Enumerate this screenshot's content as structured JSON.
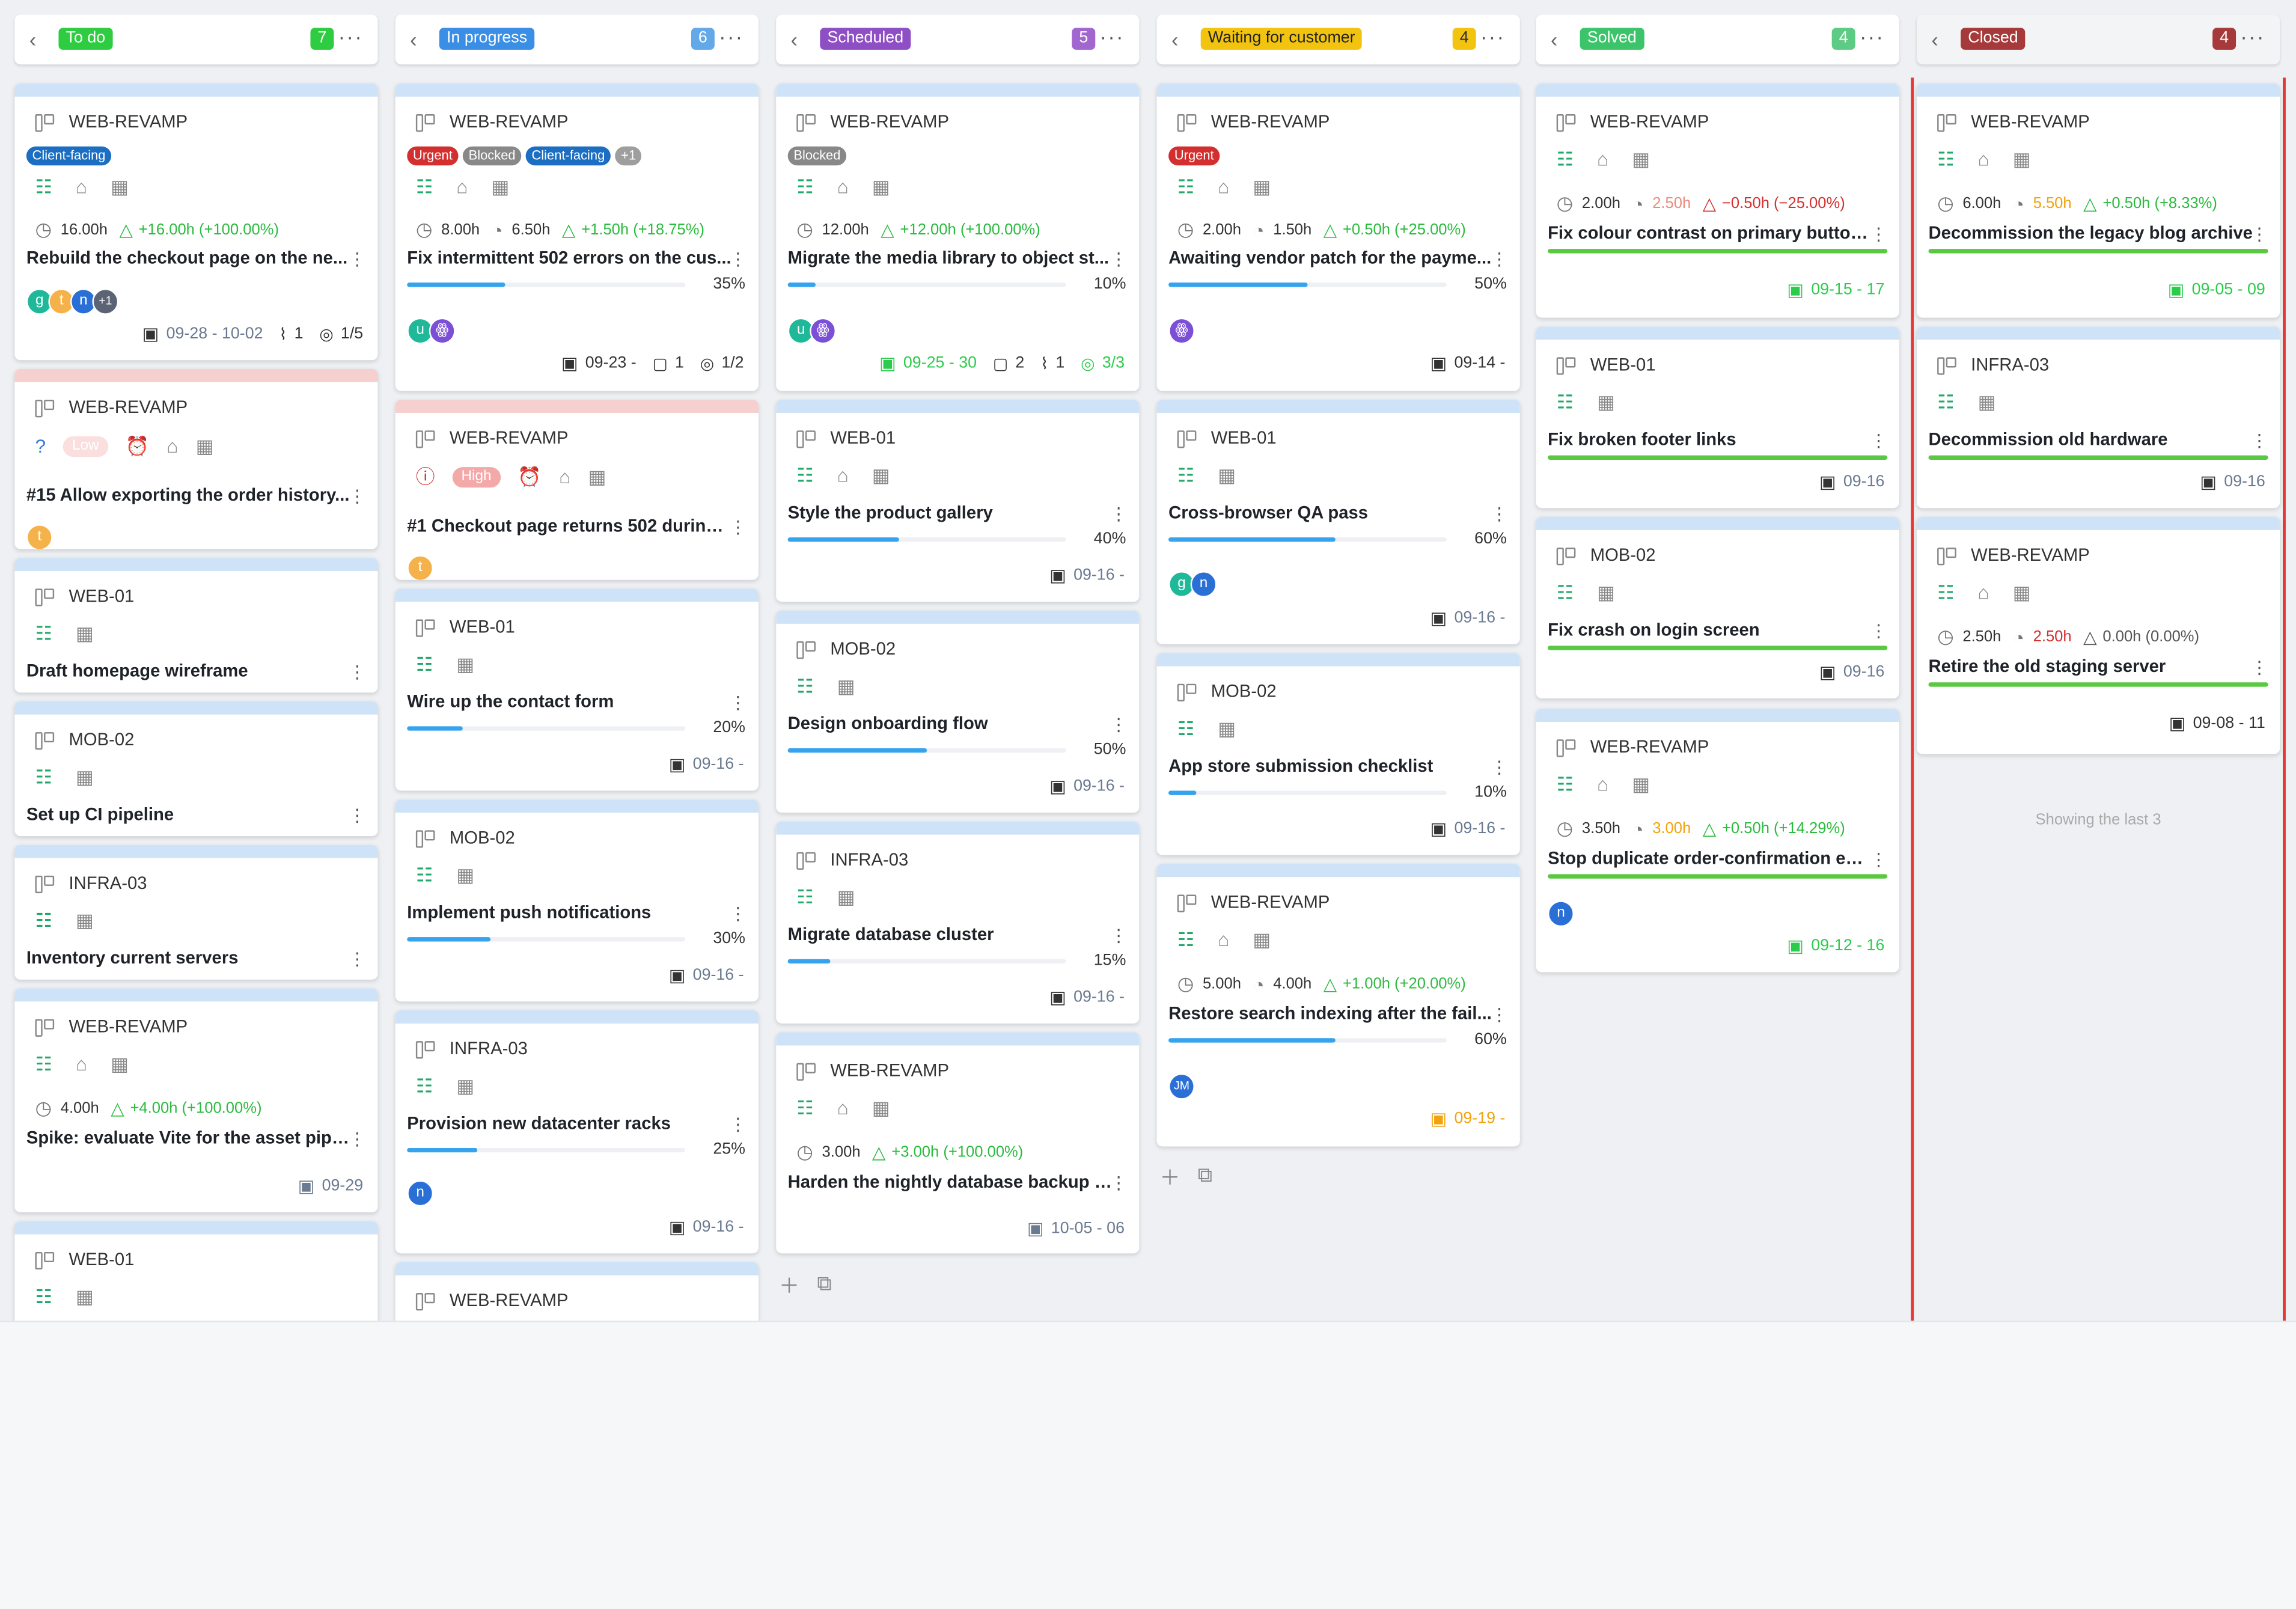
{
  "columns": [
    {
      "title": "To do",
      "count": "7",
      "tag_color": "#2ecc40",
      "count_color": "#2ecc40",
      "cards": [
        {
          "project": "WEB-REVAMP",
          "labels": [
            {
              "text": "Client-facing",
              "color": "#1b6ec2"
            }
          ],
          "estimate": "16.00h",
          "delta": "+16.00h (+100.00%)",
          "title": "Rebuild the checkout page on the ne...",
          "avatars": [
            {
              "text": "g",
              "color": "#1fb99a"
            },
            {
              "text": "t",
              "color": "#f6b24a"
            },
            {
              "text": "n",
              "color": "#2a6fd6"
            },
            {
              "text": "+1",
              "color": "#5b6475"
            }
          ],
          "date": "09-28 - 10-02",
          "attachments": "1",
          "checklist": "1/5"
        },
        {
          "project": "WEB-REVAMP",
          "priority": "Low",
          "title": "#15 Allow exporting the order history...",
          "avatars": [
            {
              "text": "t",
              "color": "#f6b24a"
            }
          ]
        },
        {
          "project": "WEB-01",
          "title": "Draft homepage wireframe"
        },
        {
          "project": "MOB-02",
          "title": "Set up CI pipeline"
        },
        {
          "project": "INFRA-03",
          "title": "Inventory current servers"
        },
        {
          "project": "WEB-REVAMP",
          "estimate": "4.00h",
          "delta": "+4.00h (+100.00%)",
          "title": "Spike: evaluate Vite for the asset pipe...",
          "date": "09-29"
        },
        {
          "project": "WEB-01"
        }
      ]
    },
    {
      "title": "In progress",
      "count": "6",
      "tag_color": "#3a8ee6",
      "count_color": "#63a8e8",
      "cards": [
        {
          "project": "WEB-REVAMP",
          "labels": [
            {
              "text": "Urgent",
              "color": "#d32f2f"
            },
            {
              "text": "Blocked",
              "color": "#888"
            },
            {
              "text": "Client-facing",
              "color": "#1b6ec2"
            },
            {
              "text": "+1",
              "color": "#9e9e9e"
            }
          ],
          "estimate": "8.00h",
          "spent": "6.50h",
          "delta": "+1.50h (+18.75%)",
          "title": "Fix intermittent 502 errors on the cus...",
          "progress": "35%",
          "avatars": [
            {
              "text": "u",
              "color": "#1fb99a"
            },
            {
              "text": "ꙮ",
              "color": "#7b4fd6"
            }
          ],
          "date": "09-23 -",
          "comments": "1",
          "checklist": "1/2"
        },
        {
          "project": "WEB-REVAMP",
          "priority": "High",
          "title": "#1 Checkout page returns 502 during ...",
          "avatars": [
            {
              "text": "t",
              "color": "#f6b24a"
            }
          ]
        },
        {
          "project": "WEB-01",
          "title": "Wire up the contact form",
          "progress": "20%",
          "date": "09-16 -"
        },
        {
          "project": "MOB-02",
          "title": "Implement push notifications",
          "progress": "30%",
          "date": "09-16 -"
        },
        {
          "project": "INFRA-03",
          "title": "Provision new datacenter racks",
          "progress": "25%",
          "avatars": [
            {
              "text": "n",
              "color": "#2a6fd6"
            }
          ],
          "date": "09-16 -"
        },
        {
          "project": "WEB-REVAMP"
        }
      ]
    },
    {
      "title": "Scheduled",
      "count": "5",
      "tag_color": "#8e4fc4",
      "count_color": "#a267cf",
      "cards": [
        {
          "project": "WEB-REVAMP",
          "labels": [
            {
              "text": "Blocked",
              "color": "#888"
            }
          ],
          "estimate": "12.00h",
          "delta": "+12.00h (+100.00%)",
          "title": "Migrate the media library to object st...",
          "progress": "10%",
          "avatars": [
            {
              "text": "u",
              "color": "#1fb99a"
            },
            {
              "text": "ꙮ",
              "color": "#7b4fd6"
            }
          ],
          "date": "09-25 - 30",
          "comments": "2",
          "attachments": "1",
          "checklist": "3/3"
        },
        {
          "project": "WEB-01",
          "title": "Style the product gallery",
          "progress": "40%",
          "date": "09-16 -"
        },
        {
          "project": "MOB-02",
          "title": "Design onboarding flow",
          "progress": "50%",
          "date": "09-16 -"
        },
        {
          "project": "INFRA-03",
          "title": "Migrate database cluster",
          "progress": "15%",
          "date": "09-16 -"
        },
        {
          "project": "WEB-REVAMP",
          "estimate": "3.00h",
          "delta": "+3.00h (+100.00%)",
          "title": "Harden the nightly database backup j...",
          "date": "10-05 - 06"
        }
      ]
    },
    {
      "title": "Waiting for customer",
      "count": "4",
      "tag_color": "#f2c40f",
      "count_color": "#f2c40f",
      "cards": [
        {
          "project": "WEB-REVAMP",
          "labels": [
            {
              "text": "Urgent",
              "color": "#d32f2f"
            }
          ],
          "estimate": "2.00h",
          "spent": "1.50h",
          "delta": "+0.50h (+25.00%)",
          "title": "Awaiting vendor patch for the payme...",
          "progress": "50%",
          "avatars": [
            {
              "text": "ꙮ",
              "color": "#7b4fd6"
            }
          ],
          "date": "09-14 -"
        },
        {
          "project": "WEB-01",
          "title": "Cross-browser QA pass",
          "progress": "60%",
          "avatars": [
            {
              "text": "g",
              "color": "#1fb99a"
            },
            {
              "text": "n",
              "color": "#2a6fd6"
            }
          ],
          "date": "09-16 -"
        },
        {
          "project": "MOB-02",
          "title": "App store submission checklist",
          "progress": "10%",
          "date": "09-16 -"
        },
        {
          "project": "WEB-REVAMP",
          "estimate": "5.00h",
          "spent": "4.00h",
          "delta": "+1.00h (+20.00%)",
          "title": "Restore search indexing after the fail...",
          "progress": "60%",
          "avatars": [
            {
              "text": "JM",
              "color": "#2a6fd6"
            }
          ],
          "date": "09-19 -"
        }
      ]
    },
    {
      "title": "Solved",
      "count": "4",
      "tag_color": "#3cc46a",
      "count_color": "#5ccb83",
      "cards": [
        {
          "project": "WEB-REVAMP",
          "estimate": "2.00h",
          "spent": "2.50h",
          "delta": "−0.50h (−25.00%)",
          "title": "Fix colour contrast on primary button...",
          "date": "09-15 - 17"
        },
        {
          "project": "WEB-01",
          "title": "Fix broken footer links",
          "date": "09-16"
        },
        {
          "project": "MOB-02",
          "title": "Fix crash on login screen",
          "date": "09-16"
        },
        {
          "project": "WEB-REVAMP",
          "estimate": "3.50h",
          "spent": "3.00h",
          "delta": "+0.50h (+14.29%)",
          "title": "Stop duplicate order-confirmation em...",
          "avatars": [
            {
              "text": "n",
              "color": "#2a6fd6"
            }
          ],
          "date": "09-12 - 16"
        }
      ]
    },
    {
      "title": "Closed",
      "count": "4",
      "tag_color": "#a63a3a",
      "count_color": "#a63a3a",
      "cards": [
        {
          "project": "WEB-REVAMP",
          "estimate": "6.00h",
          "spent": "5.50h",
          "delta": "+0.50h (+8.33%)",
          "title": "Decommission the legacy blog archive",
          "date": "09-05 - 09"
        },
        {
          "project": "INFRA-03",
          "title": "Decommission old hardware",
          "date": "09-16"
        },
        {
          "project": "WEB-REVAMP",
          "estimate": "2.50h",
          "spent": "2.50h",
          "delta": "0.00h (0.00%)",
          "title": "Retire the old staging server",
          "date": "09-08 - 11"
        }
      ],
      "footer_note": "Showing the last 3"
    }
  ]
}
